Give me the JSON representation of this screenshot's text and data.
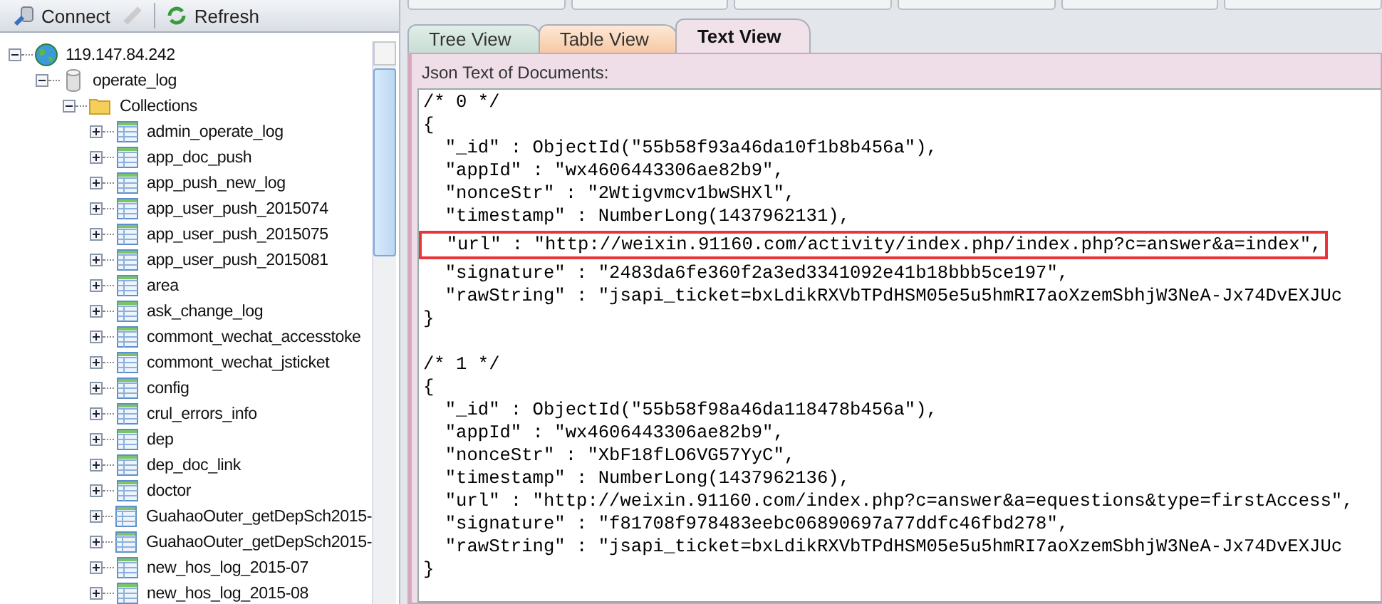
{
  "toolbar": {
    "buttons": [
      {
        "label": "Connect",
        "kind": "connect",
        "disabled": false
      },
      {
        "kind": "disconnect",
        "disabled": true
      },
      {
        "label": "Refresh",
        "kind": "refresh",
        "disabled": false
      }
    ]
  },
  "tree": [
    {
      "label": "119.147.84.242",
      "kind": "server",
      "expanded": true,
      "children": [
        {
          "label": "operate_log",
          "kind": "database",
          "expanded": true,
          "children": [
            {
              "label": "Collections",
              "kind": "folder",
              "expanded": true,
              "children": [
                {
                  "label": "admin_operate_log",
                  "kind": "collection",
                  "expanded": false
                },
                {
                  "label": "app_doc_push",
                  "kind": "collection",
                  "expanded": false
                },
                {
                  "label": "app_push_new_log",
                  "kind": "collection",
                  "expanded": false
                },
                {
                  "label": "app_user_push_2015074",
                  "kind": "collection",
                  "expanded": false
                },
                {
                  "label": "app_user_push_2015075",
                  "kind": "collection",
                  "expanded": false
                },
                {
                  "label": "app_user_push_2015081",
                  "kind": "collection",
                  "expanded": false
                },
                {
                  "label": "area",
                  "kind": "collection",
                  "expanded": false
                },
                {
                  "label": "ask_change_log",
                  "kind": "collection",
                  "expanded": false
                },
                {
                  "label": "commont_wechat_accesstoke",
                  "kind": "collection",
                  "expanded": false
                },
                {
                  "label": "commont_wechat_jsticket",
                  "kind": "collection",
                  "expanded": false
                },
                {
                  "label": "config",
                  "kind": "collection",
                  "expanded": false
                },
                {
                  "label": "crul_errors_info",
                  "kind": "collection",
                  "expanded": false
                },
                {
                  "label": "dep",
                  "kind": "collection",
                  "expanded": false
                },
                {
                  "label": "dep_doc_link",
                  "kind": "collection",
                  "expanded": false
                },
                {
                  "label": "doctor",
                  "kind": "collection",
                  "expanded": false
                },
                {
                  "label": "GuahaoOuter_getDepSch2015-",
                  "kind": "collection",
                  "expanded": false
                },
                {
                  "label": "GuahaoOuter_getDepSch2015-",
                  "kind": "collection",
                  "expanded": false
                },
                {
                  "label": "new_hos_log_2015-07",
                  "kind": "collection",
                  "expanded": false
                },
                {
                  "label": "new_hos_log_2015-08",
                  "kind": "collection",
                  "expanded": false
                }
              ]
            }
          ]
        }
      ]
    }
  ],
  "tabs": [
    {
      "label": "Tree View",
      "kind": "tree",
      "selected": false
    },
    {
      "label": "Table View",
      "kind": "table",
      "selected": false
    },
    {
      "label": "Text View",
      "kind": "text",
      "selected": true
    }
  ],
  "editor": {
    "label": "Json Text of Documents:",
    "documents": [
      {
        "lines": [
          {
            "text": "/* 0 */",
            "highlighted": false
          },
          {
            "text": "{",
            "highlighted": false
          },
          {
            "text": "  \"_id\" : ObjectId(\"55b58f93a46da10f1b8b456a\"),",
            "highlighted": false
          },
          {
            "text": "  \"appId\" : \"wx4606443306ae82b9\",",
            "highlighted": false
          },
          {
            "text": "  \"nonceStr\" : \"2Wtigvmcv1bwSHXl\",",
            "highlighted": false
          },
          {
            "text": "  \"timestamp\" : NumberLong(1437962131),",
            "highlighted": false
          },
          {
            "text": "  \"url\" : \"http://weixin.91160.com/activity/index.php/index.php?c=answer&a=index\",",
            "highlighted": true
          },
          {
            "text": "  \"signature\" : \"2483da6fe360f2a3ed3341092e41b18bbb5ce197\",",
            "highlighted": false
          },
          {
            "text": "  \"rawString\" : \"jsapi_ticket=bxLdikRXVbTPdHSM05e5u5hmRI7aoXzemSbhjW3NeA-Jx74DvEXJUc",
            "highlighted": false
          },
          {
            "text": "}",
            "highlighted": false
          }
        ]
      },
      {
        "lines": [
          {
            "text": "/* 1 */",
            "highlighted": false
          },
          {
            "text": "{",
            "highlighted": false
          },
          {
            "text": "  \"_id\" : ObjectId(\"55b58f98a46da118478b456a\"),",
            "highlighted": false
          },
          {
            "text": "  \"appId\" : \"wx4606443306ae82b9\",",
            "highlighted": false
          },
          {
            "text": "  \"nonceStr\" : \"XbF18fLO6VG57YyC\",",
            "highlighted": false
          },
          {
            "text": "  \"timestamp\" : NumberLong(1437962136),",
            "highlighted": false
          },
          {
            "text": "  \"url\" : \"http://weixin.91160.com/index.php?c=answer&a=equestions&type=firstAccess\",",
            "highlighted": false
          },
          {
            "text": "  \"signature\" : \"f81708f978483eebc06890697a77ddfc46fbd278\",",
            "highlighted": false
          },
          {
            "text": "  \"rawString\" : \"jsapi_ticket=bxLdikRXVbTPdHSM05e5u5hmRI7aoXzemSbhjW3NeA-Jx74DvEXJUc",
            "highlighted": false
          },
          {
            "text": "}",
            "highlighted": false
          }
        ]
      }
    ]
  }
}
